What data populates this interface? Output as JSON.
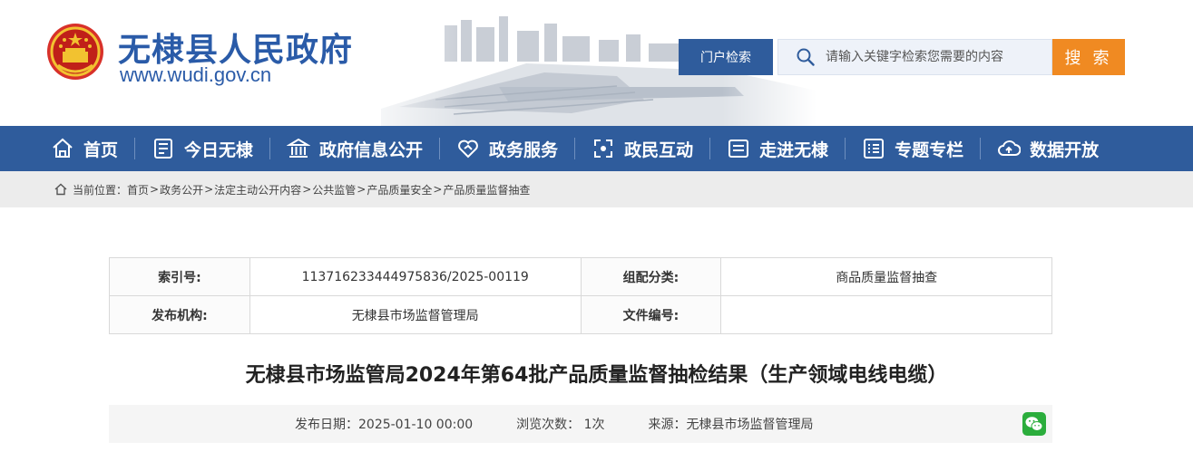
{
  "site": {
    "name": "无棣县人民政府",
    "url": "www.wudi.gov.cn"
  },
  "search": {
    "portal_label": "门户检索",
    "placeholder": "请输入关键字检索您需要的内容",
    "button_label": "搜 索"
  },
  "nav": {
    "items": [
      {
        "label": "首页",
        "icon": "home-icon"
      },
      {
        "label": "今日无棣",
        "icon": "newspaper-icon"
      },
      {
        "label": "政府信息公开",
        "icon": "government-building-icon"
      },
      {
        "label": "政务服务",
        "icon": "handshake-icon"
      },
      {
        "label": "政民互动",
        "icon": "interaction-icon"
      },
      {
        "label": "走进无棣",
        "icon": "intro-card-icon"
      },
      {
        "label": "专题专栏",
        "icon": "list-icon"
      },
      {
        "label": "数据开放",
        "icon": "cloud-upload-icon"
      }
    ]
  },
  "breadcrumb": {
    "prefix": "当前位置：",
    "items": [
      "首页",
      "政务公开",
      "法定主动公开内容",
      "公共监管",
      "产品质量安全",
      "产品质量监督抽查"
    ],
    "separator": ">"
  },
  "meta": {
    "index_label": "索引号:",
    "index_value": "11371623344497583​6/2025-00119",
    "category_label": "组配分类:",
    "category_value": "商品质量监督抽查",
    "publisher_label": "发布机构:",
    "publisher_value": "无棣县市场监督管理局",
    "doc_no_label": "文件编号:",
    "doc_no_value": ""
  },
  "article": {
    "title": "无棣县市场监管局2024年第64批产品质量监督抽检结果（生产领域电线电缆）",
    "date": "发布日期：2025-01-10 00:00",
    "views": "浏览次数： 1次",
    "source": "来源：无棣县市场监督管理局"
  },
  "colors": {
    "primary": "#2f5c9c",
    "accent": "#f08a22",
    "brand_text": "#2a5ba8"
  }
}
